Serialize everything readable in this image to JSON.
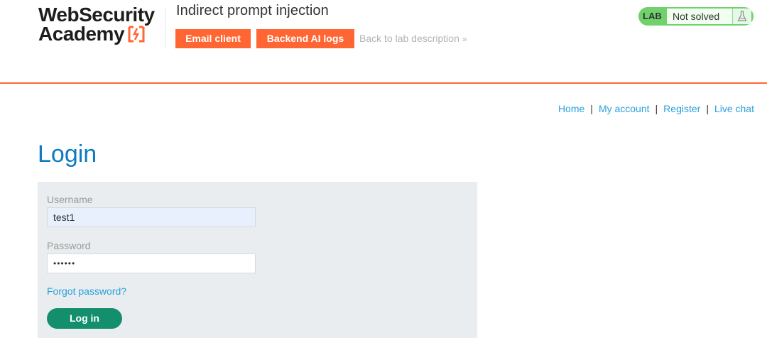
{
  "logo": {
    "line1": "WebSecurity",
    "line2": "Academy"
  },
  "lab": {
    "title": "Indirect prompt injection",
    "email_client_label": "Email client",
    "backend_logs_label": "Backend AI logs",
    "back_link_label": "Back to lab description",
    "badge": "LAB",
    "status": "Not solved"
  },
  "nav": {
    "home": "Home",
    "my_account": "My account",
    "register": "Register",
    "live_chat": "Live chat",
    "separator": "|"
  },
  "login": {
    "title": "Login",
    "username_label": "Username",
    "username_value": "test1",
    "password_label": "Password",
    "password_value": "••••••",
    "forgot_label": "Forgot password?",
    "submit_label": "Log in"
  },
  "colors": {
    "accent": "#ff6633",
    "link": "#29a0db",
    "title": "#0e7abf",
    "button": "#148f6e",
    "lab_status": "#70d16d"
  },
  "icons": {
    "logo_mark": "lightning-bracket-icon",
    "flask": "flask-icon",
    "back_chevron": "double-chevron-right-icon"
  }
}
